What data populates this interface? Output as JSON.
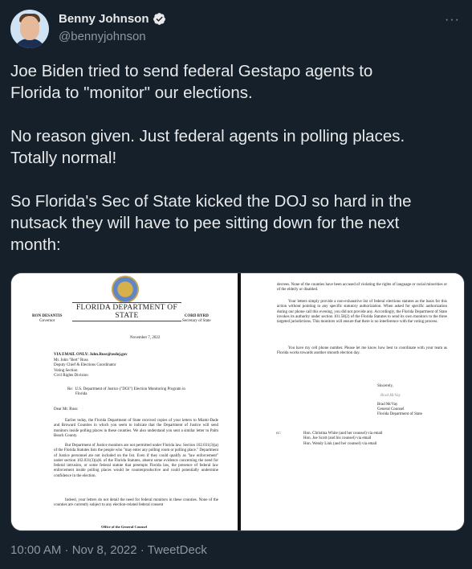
{
  "author": {
    "name": "Benny Johnson",
    "handle": "@bennyjohnson",
    "verified_icon": "verified-badge-icon"
  },
  "more_label": "···",
  "tweet": {
    "text": "Joe Biden tried to send federal Gestapo agents to\nFlorida to \"monitor\" our elections.\n\nNo reason given. Just federal agents in polling places.\nTotally normal!\n\nSo Florida's Sec of State kicked the DOJ so hard in the\nnutsack they will have to pee sitting down for the next\nmonth:"
  },
  "timestamp": "10:00 AM · Nov 8, 2022 · TweetDeck",
  "letter": {
    "left": {
      "department": "FLORIDA DEPARTMENT OF STATE",
      "governor_name": "RON DESANTIS",
      "governor_title": "Governor",
      "secretary_name": "CORD BYRD",
      "secretary_title": "Secretary of State",
      "date": "November 7, 2022",
      "via_email": "VIA EMAIL ONLY: John.Russ@usdoj.gov",
      "addressee": "Mr. John \"Bert\" Russ\nDeputy Chief & Elections Coordinator\nVoting Section\nCivil Rights Division",
      "re": "Re:  U.S. Department of Justice (\"DOJ\") Election Monitoring Program in\n        Florida",
      "salutation": "Dear Mr. Russ:",
      "para1": "Earlier today, the Florida Department of State received copies of your letters to Miami-Dade and Broward Counties in which you seem to indicate that the Department of Justice will send monitors inside polling places in these counties. We also understand you sent a similar letter to Palm Beach County.",
      "para2": "But Department of Justice monitors are not permitted under Florida law. Section 102.031(3)(a) of the Florida Statutes lists the people who \"may enter any polling room or polling place.\" Department of Justice personnel are not included on the list. Even if they could qualify as \"law enforcement\" under section 102.031(3)(a)6. of the Florida Statutes, absent some evidence concerning the need for federal intrusion, or some federal statute that preempts Florida law, the presence of federal law enforcement inside polling places would be counterproductive and could potentially undermine confidence in the election.",
      "para3": "Indeed, your letters do not detail the need for federal monitors in these counties. None of the counties are currently subject to any election-related federal consent",
      "footer": "Office of the General Counsel"
    },
    "right": {
      "para0": "decrees. None of the counties have been accused of violating the rights of language or racial minorities or of the elderly or disabled.",
      "para1": "Your letters simply provide a non-exhaustive list of federal elections statutes as the basis for this action without pointing to any specific statutory authorization. When asked for specific authorization during our phone call this evening, you did not provide any. Accordingly, the Florida Department of State invokes its authority under section 101.58(2) of the Florida Statutes to send its own monitors to the three targeted jurisdictions. This monitors will ensure that there is no interference with the voting process.",
      "para2": "You have my cell phone number. Please let me know how best to coordinate with your team as Florida works towards another smooth election day.",
      "closing": "Sincerely,",
      "signature": "Brad McVay",
      "signer": "Brad McVay\nGeneral Counsel\nFlorida Department of State",
      "cc_label": "cc:",
      "cc_list": "Hon. Christina White (and her counsel) via email\nHon. Joe Scott (and his counsel) via email\nHon. Wendy Link (and her counsel) via email"
    }
  }
}
